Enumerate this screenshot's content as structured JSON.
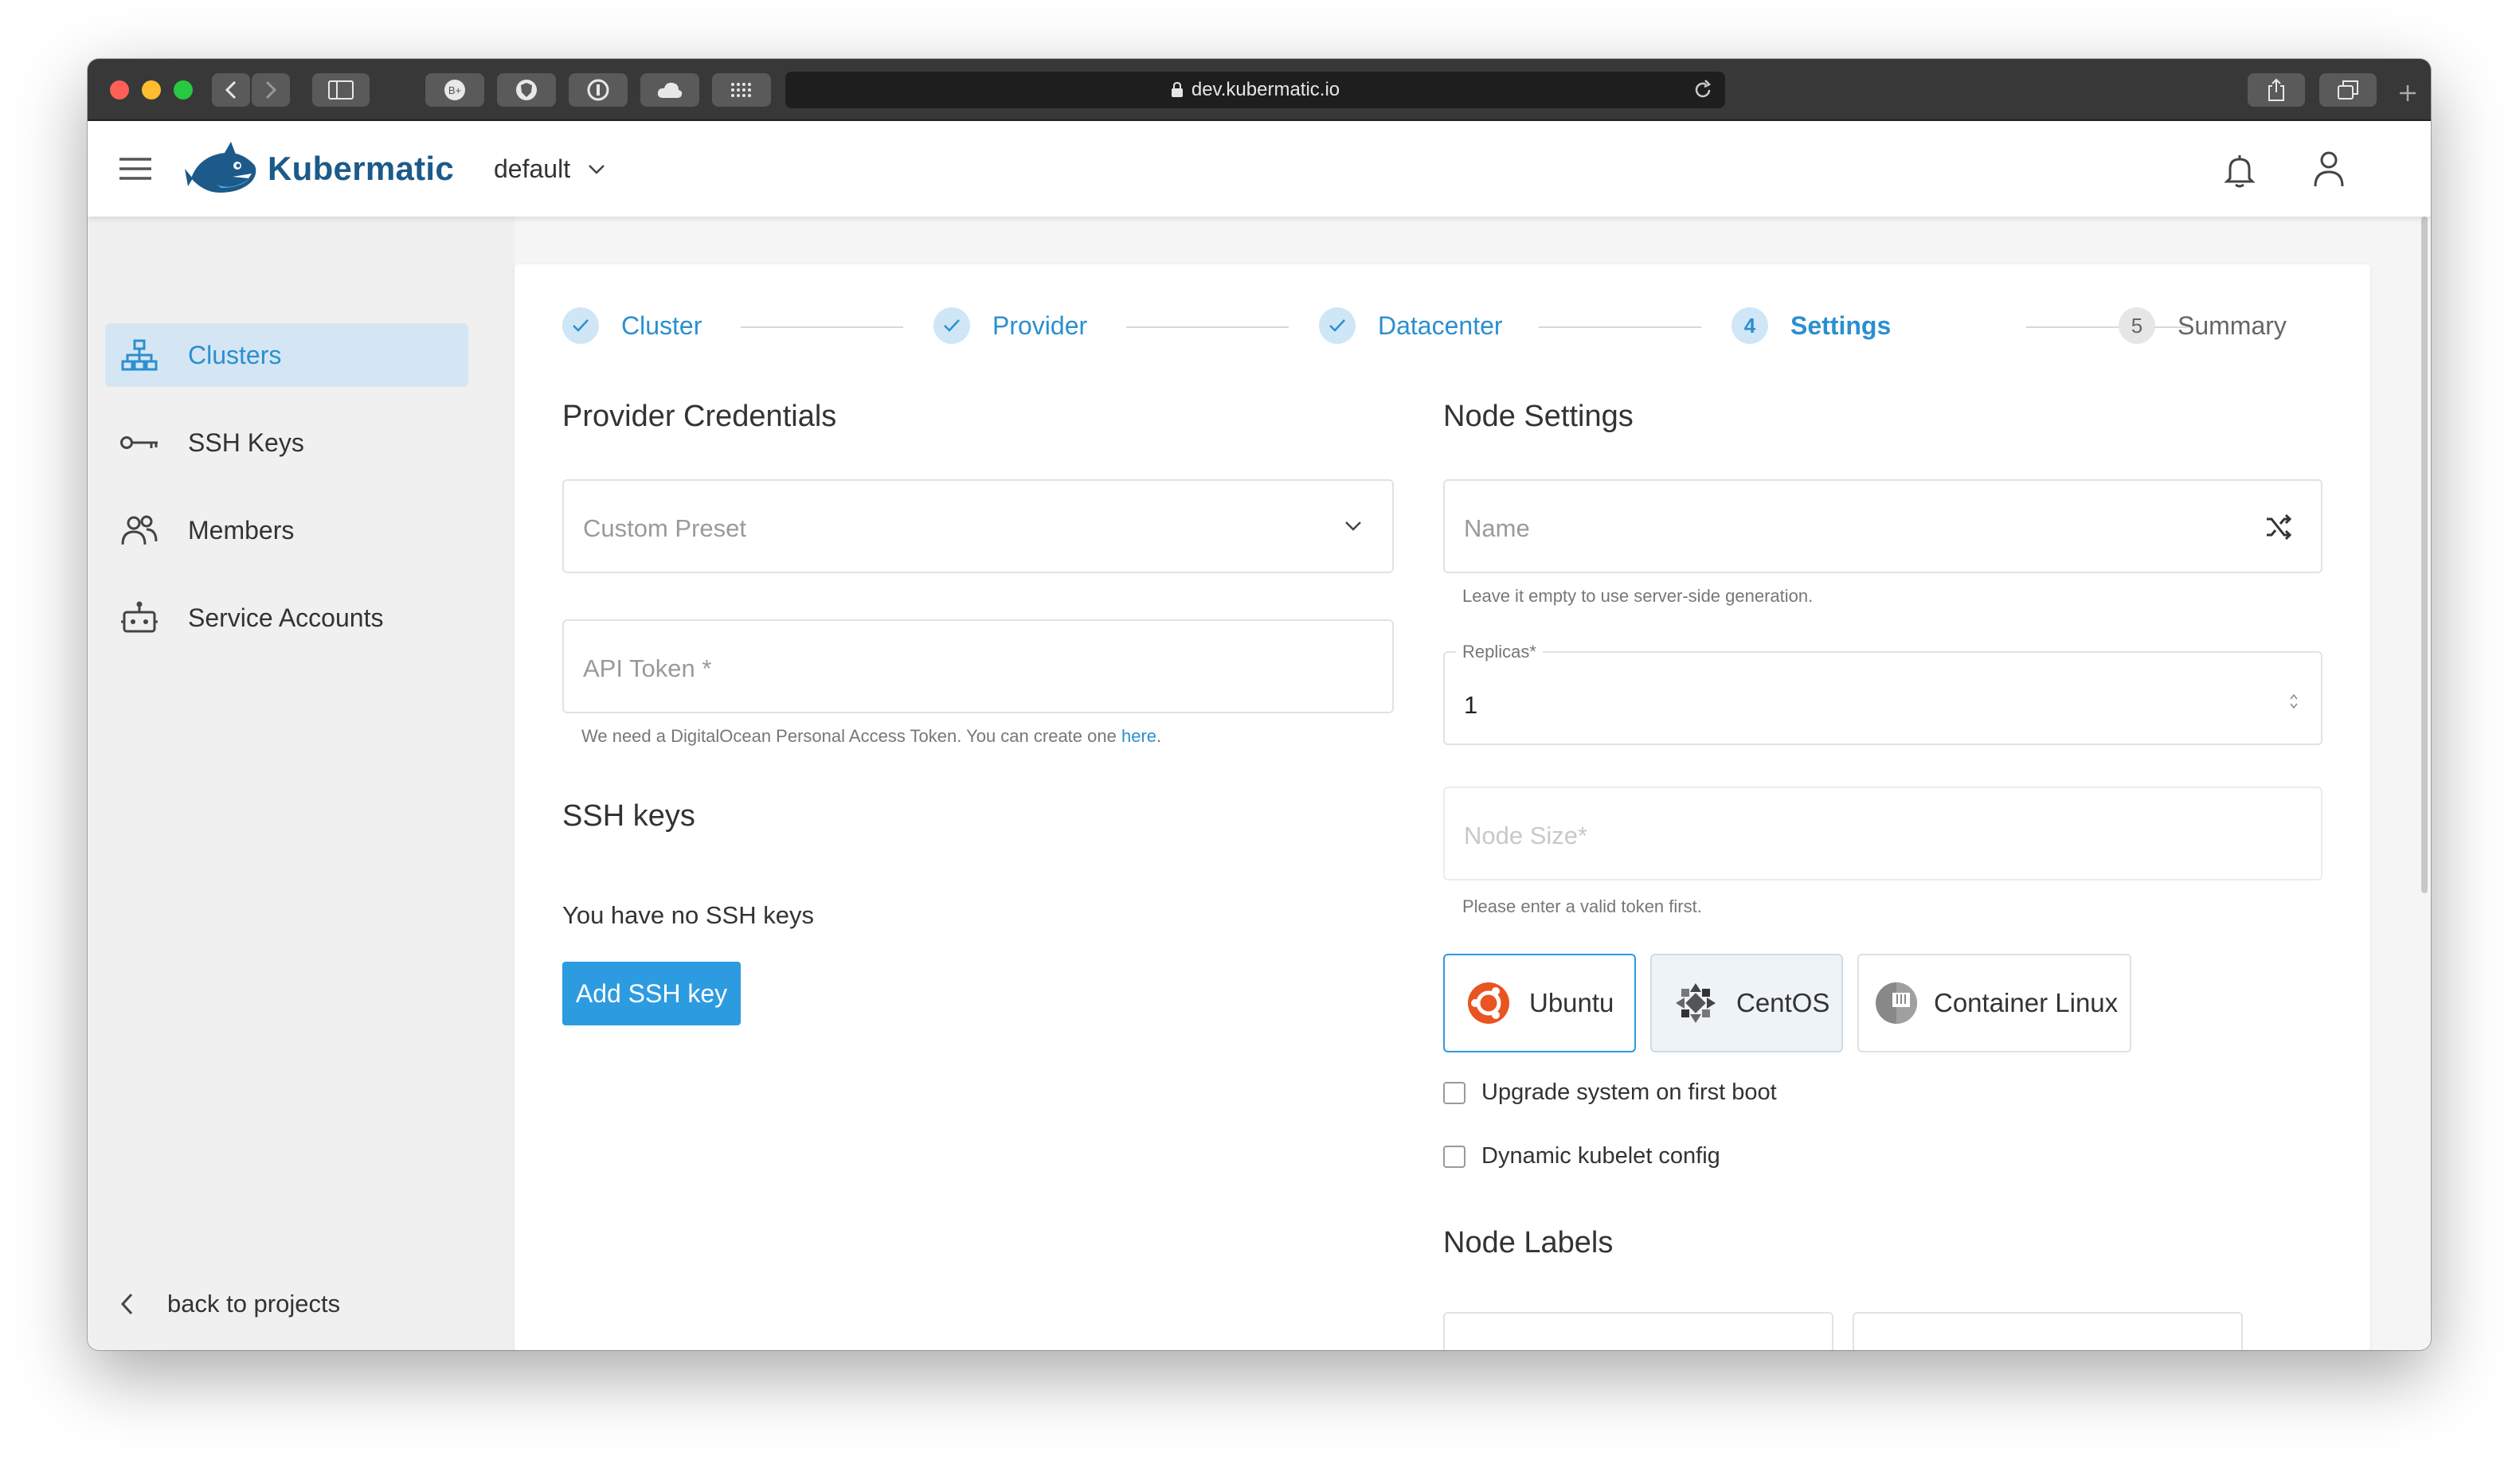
{
  "browser": {
    "url": "dev.kubermatic.io"
  },
  "header": {
    "brand": "Kubermatic",
    "project": "default"
  },
  "sidebar": {
    "items": [
      {
        "label": "Clusters",
        "icon": "sitemap-icon",
        "active": true
      },
      {
        "label": "SSH Keys",
        "icon": "key-icon",
        "active": false
      },
      {
        "label": "Members",
        "icon": "members-icon",
        "active": false
      },
      {
        "label": "Service Accounts",
        "icon": "robot-icon",
        "active": false
      }
    ],
    "back_label": "back to projects"
  },
  "stepper": {
    "steps": [
      {
        "label": "Cluster",
        "state": "done"
      },
      {
        "label": "Provider",
        "state": "done"
      },
      {
        "label": "Datacenter",
        "state": "done"
      },
      {
        "label": "Settings",
        "state": "current",
        "number": "4"
      },
      {
        "label": "Summary",
        "state": "future",
        "number": "5"
      }
    ]
  },
  "provider": {
    "title": "Provider Credentials",
    "preset_placeholder": "Custom Preset",
    "token_placeholder": "API Token *",
    "token_hint": "We need a DigitalOcean Personal Access Token. You can create one",
    "token_hint_link": "here",
    "token_hint_end": "."
  },
  "ssh": {
    "title": "SSH keys",
    "empty_text": "You have no SSH keys",
    "add_button": "Add SSH key"
  },
  "node": {
    "title": "Node Settings",
    "name_placeholder": "Name",
    "name_hint": "Leave it empty to use server-side generation.",
    "replicas_label": "Replicas*",
    "replicas_value": "1",
    "size_placeholder": "Node Size*",
    "size_hint": "Please enter a valid token first.",
    "os_options": [
      {
        "label": "Ubuntu",
        "selected": true
      },
      {
        "label": "CentOS",
        "selected": false
      },
      {
        "label": "Container Linux",
        "selected": false
      }
    ],
    "upgrade_label": "Upgrade system on first boot",
    "kubelet_label": "Dynamic kubelet config",
    "labels_title": "Node Labels"
  },
  "colors": {
    "accent": "#2b8fcf",
    "brand": "#1c5a8a",
    "primary_button": "#2d9be0",
    "sidebar_active": "#d4e6f3"
  }
}
